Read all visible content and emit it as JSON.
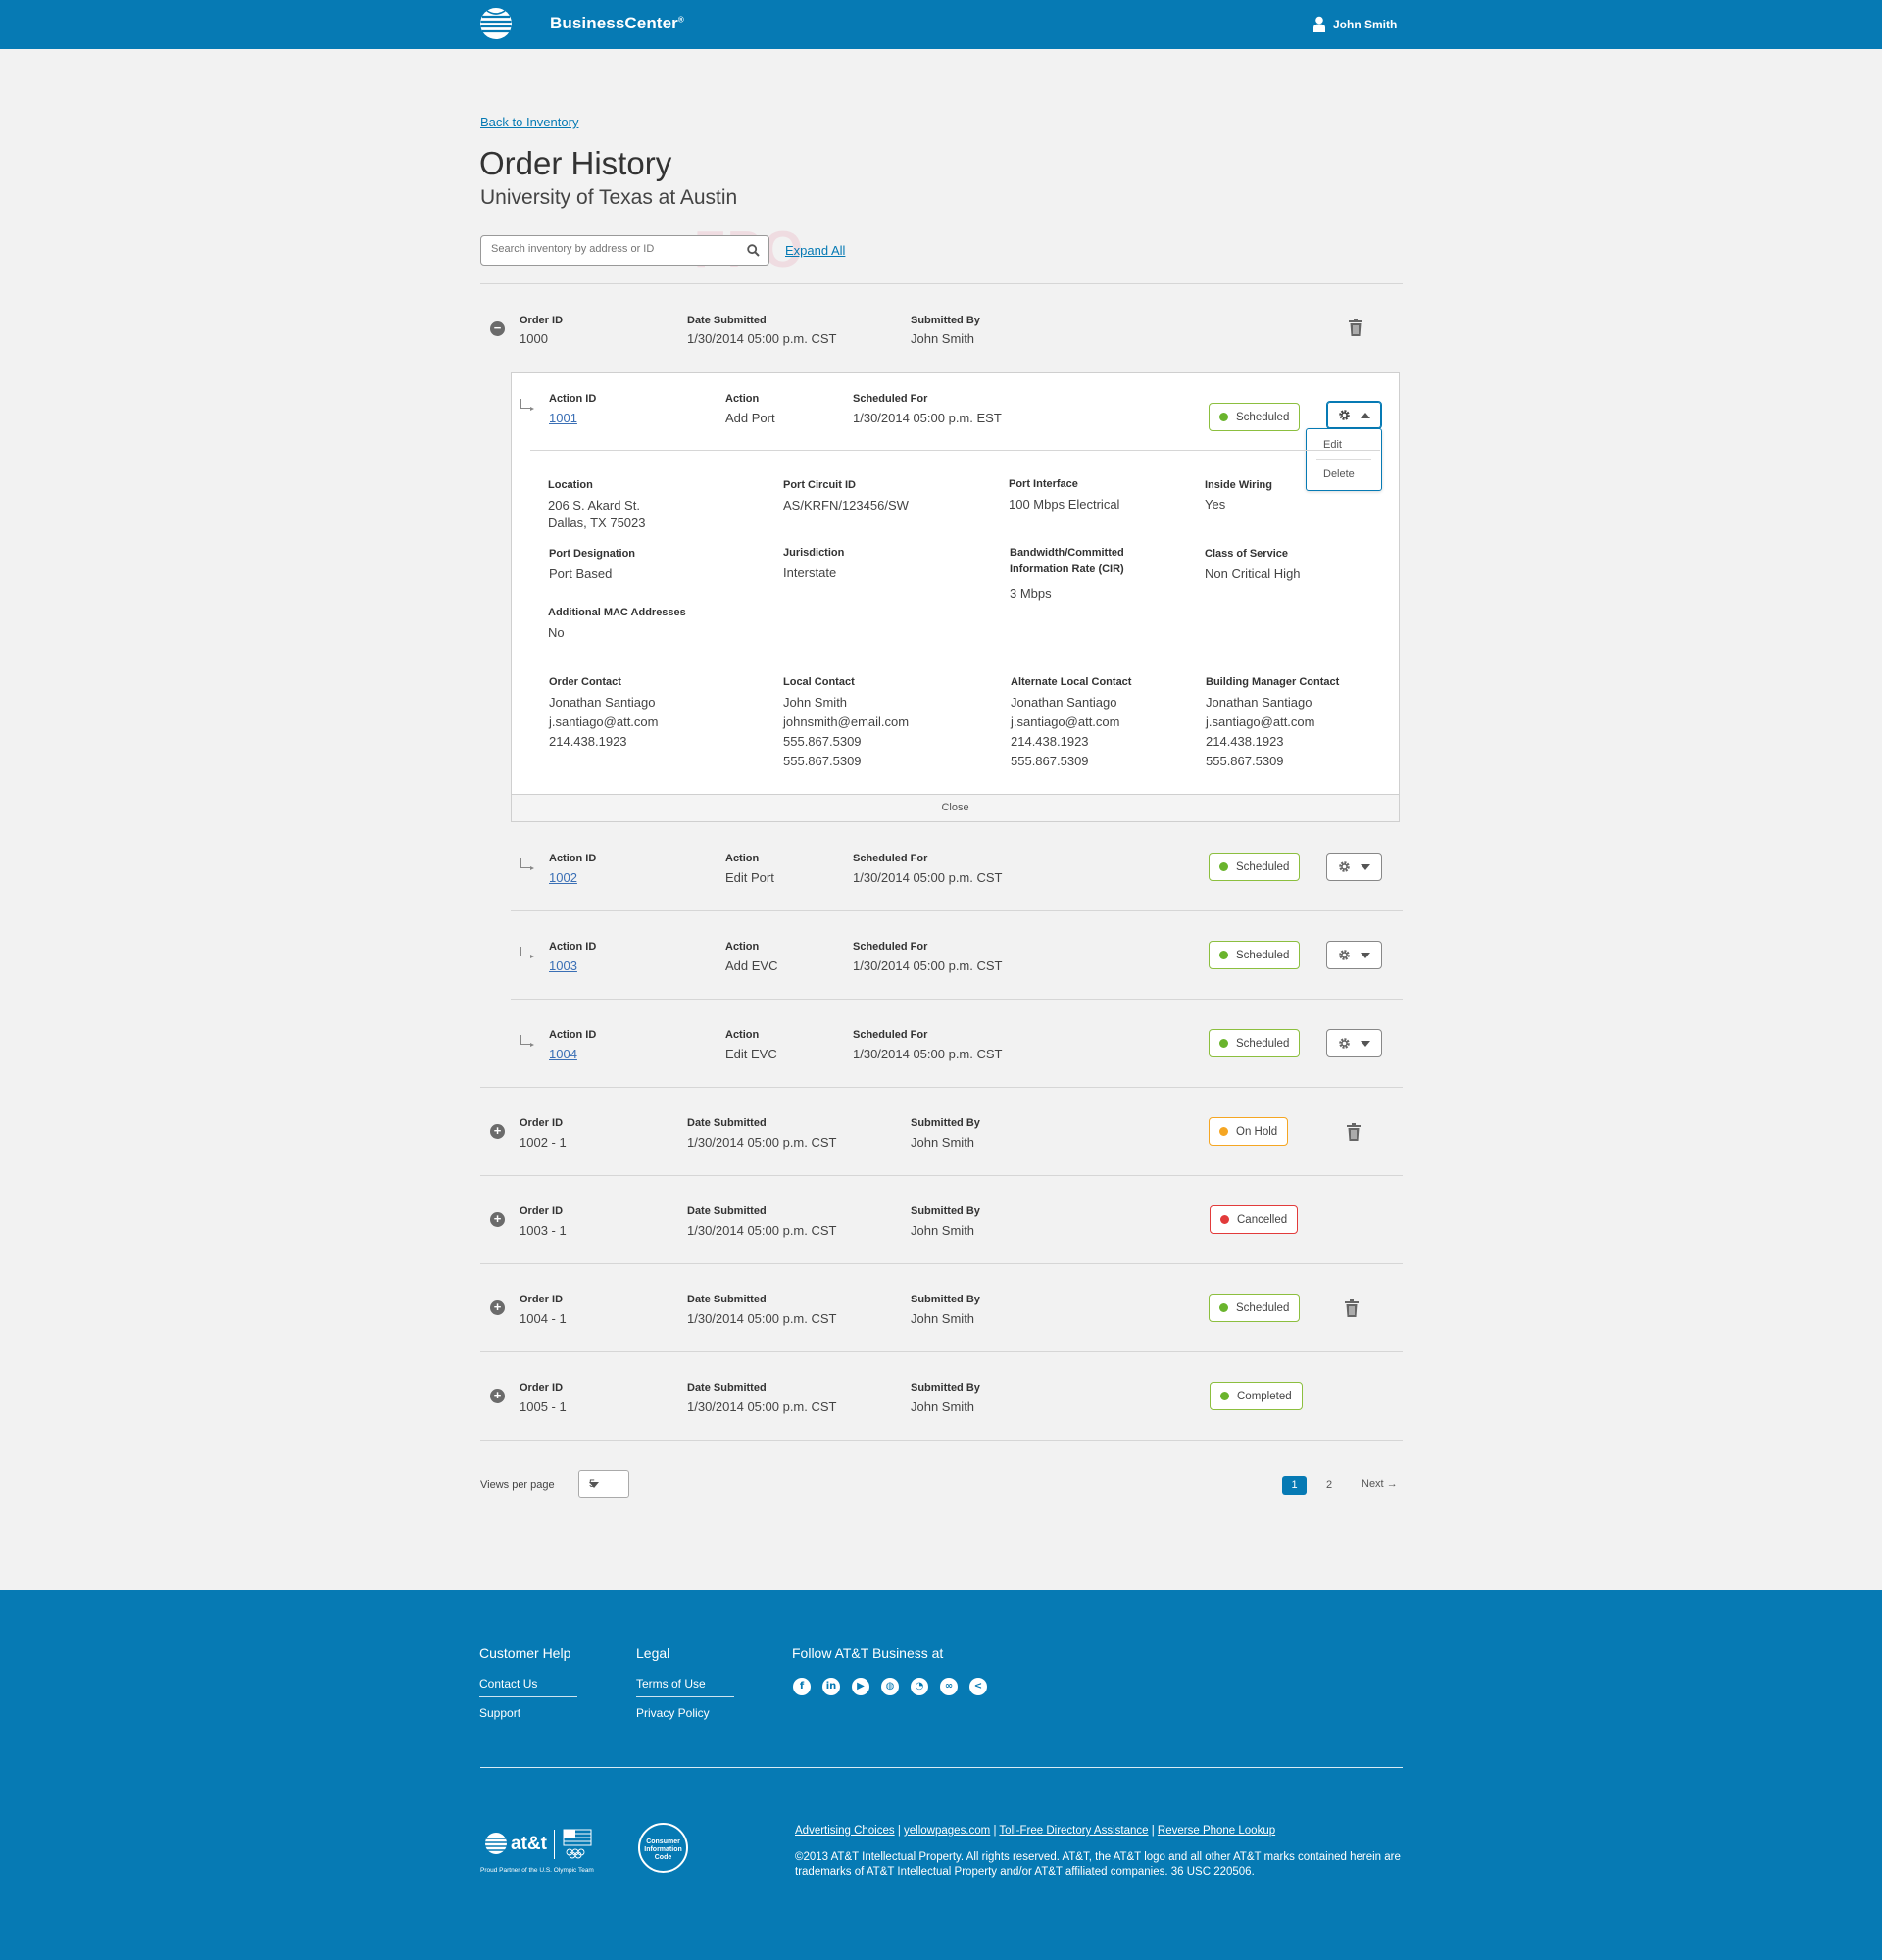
{
  "header": {
    "brand": "BusinessCenter",
    "brand_mark": "®",
    "user_name": "John Smith"
  },
  "page": {
    "back_link": "Back to Inventory",
    "title": "Order History",
    "subtitle": "University of Texas at Austin",
    "search_placeholder": "Search inventory by address or ID",
    "watermark": "FPO",
    "expand_all": "Expand All"
  },
  "labels": {
    "order_id": "Order ID",
    "date_submitted": "Date Submitted",
    "submitted_by": "Submitted By",
    "action_id": "Action ID",
    "action": "Action",
    "scheduled_for": "Scheduled For"
  },
  "order_main": {
    "order_id": "1000",
    "date": "1/30/2014 05:00 p.m. CST",
    "by": "John Smith"
  },
  "actions": [
    {
      "id": "1001",
      "action": "Add Port",
      "scheduled": "1/30/2014 05:00 p.m. EST",
      "status": "Scheduled"
    },
    {
      "id": "1002",
      "action": "Edit Port",
      "scheduled": "1/30/2014 05:00 p.m. CST",
      "status": "Scheduled"
    },
    {
      "id": "1003",
      "action": "Add EVC",
      "scheduled": "1/30/2014 05:00 p.m. CST",
      "status": "Scheduled"
    },
    {
      "id": "1004",
      "action": "Edit EVC",
      "scheduled": "1/30/2014 05:00 p.m. CST",
      "status": "Scheduled"
    }
  ],
  "menu": {
    "edit": "Edit",
    "delete": "Delete"
  },
  "details": {
    "location_label": "Location",
    "location_1": "206 S. Akard St.",
    "location_2": "Dallas, TX 75023",
    "circuit_label": "Port Circuit ID",
    "circuit": "AS/KRFN/123456/SW",
    "interface_label": "Port Interface",
    "interface": "100 Mbps Electrical",
    "wiring_label": "Inside Wiring",
    "wiring": "Yes",
    "designation_label": "Port Designation",
    "designation": "Port Based",
    "jurisdiction_label": "Jurisdiction",
    "jurisdiction": "Interstate",
    "bandwidth_label_1": "Bandwidth/Committed",
    "bandwidth_label_2": "Information Rate (CIR)",
    "bandwidth": "3 Mbps",
    "cos_label": "Class of Service",
    "cos": "Non Critical High",
    "mac_label": "Additional MAC Addresses",
    "mac": "No",
    "order_contact_label": "Order Contact",
    "order_contact": [
      "Jonathan Santiago",
      "j.santiago@att.com",
      "214.438.1923"
    ],
    "local_contact_label": "Local Contact",
    "local_contact": [
      "John Smith",
      "johnsmith@email.com",
      "555.867.5309",
      "555.867.5309"
    ],
    "alt_contact_label": "Alternate Local Contact",
    "alt_contact": [
      "Jonathan Santiago",
      "j.santiago@att.com",
      "214.438.1923",
      "555.867.5309"
    ],
    "bm_contact_label": "Building Manager Contact",
    "bm_contact": [
      "Jonathan Santiago",
      "j.santiago@att.com",
      "214.438.1923",
      "555.867.5309"
    ],
    "close": "Close"
  },
  "orders": [
    {
      "id": "1002 - 1",
      "date": "1/30/2014 05:00 p.m. CST",
      "by": "John Smith",
      "status": "On Hold"
    },
    {
      "id": "1003 - 1",
      "date": "1/30/2014 05:00 p.m. CST",
      "by": "John Smith",
      "status": "Cancelled"
    },
    {
      "id": "1004 - 1",
      "date": "1/30/2014 05:00 p.m. CST",
      "by": "John Smith",
      "status": "Scheduled"
    },
    {
      "id": "1005 - 1",
      "date": "1/30/2014 05:00 p.m. CST",
      "by": "John Smith",
      "status": "Completed"
    }
  ],
  "pagination": {
    "views_label": "Views per page",
    "per_page": "5",
    "page1": "1",
    "page2": "2",
    "next": "Next"
  },
  "footer": {
    "help_heading": "Customer Help",
    "contact": "Contact Us",
    "support": "Support",
    "legal_heading": "Legal",
    "terms": "Terms of Use",
    "privacy": "Privacy Policy",
    "follow_heading": "Follow AT&T Business at",
    "social_icons": [
      "facebook-icon",
      "linkedin-icon",
      "youtube-icon",
      "globe-icon",
      "rss-icon",
      "networking-icon",
      "share-icon"
    ],
    "logo_text": "at&t",
    "partner_text": "Proud Partner of the U.S. Olympic Team",
    "seal_text": "Consumer Information Code",
    "link_ad": "Advertising Choices",
    "link_yp": "yellowpages.com",
    "link_tf": "Toll-Free Directory Assistance",
    "link_rp": "Reverse Phone Lookup",
    "copyright": "©2013 AT&T Intellectual Property. All rights reserved. AT&T, the AT&T logo and all other AT&T marks contained herein are trademarks of AT&T Intellectual Property and/or AT&T affiliated companies. 36 USC 220506."
  },
  "colors": {
    "brand_blue": "#067ab4",
    "scheduled_green": "#6ab42d",
    "on_hold_orange": "#f5a623",
    "cancelled_red": "#e23b3b"
  }
}
